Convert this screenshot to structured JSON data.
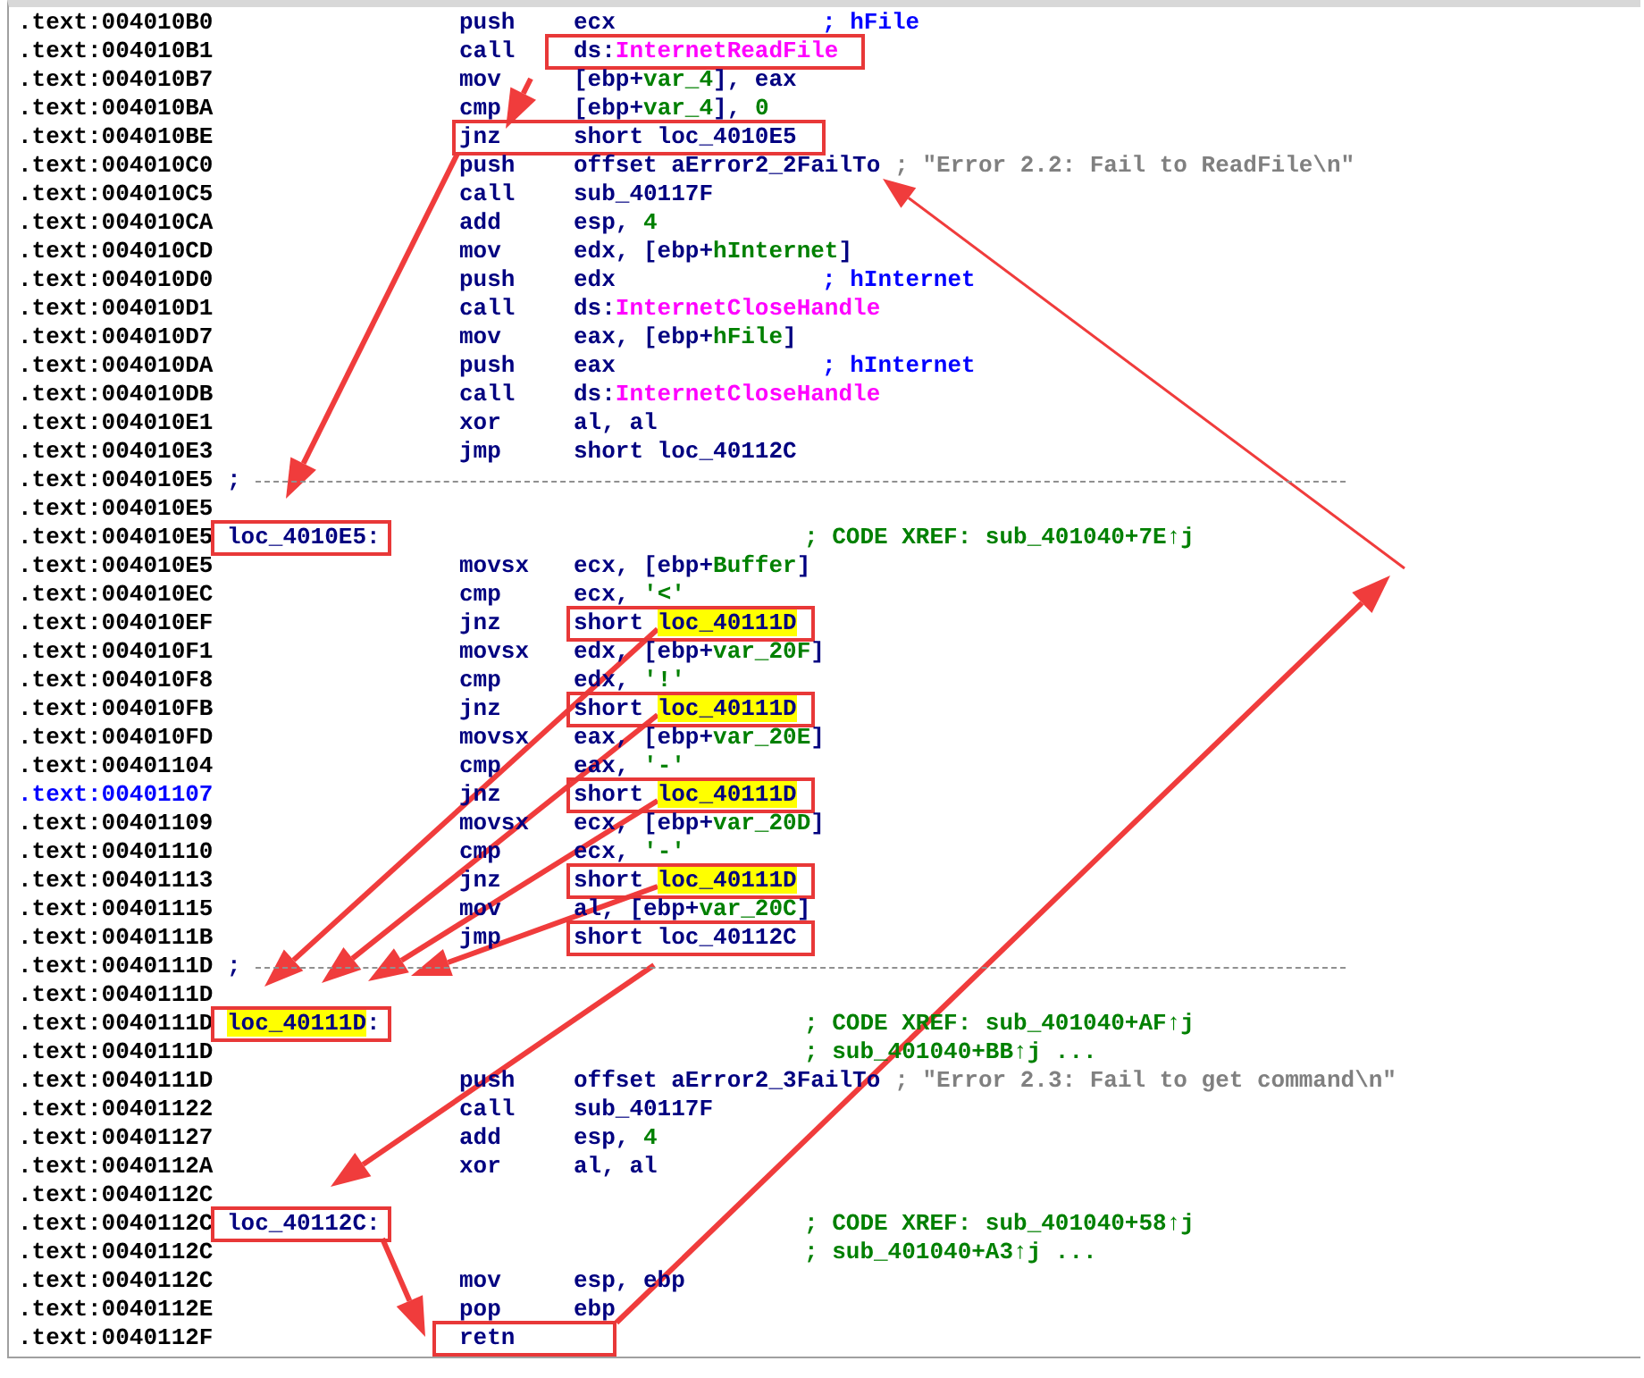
{
  "lines": [
    {
      "kind": "instruction",
      "address": ".text:004010B0",
      "mnemonic": "push",
      "operands": [
        {
          "text": "ecx",
          "kind": "reg"
        }
      ],
      "comment": {
        "text": "; hFile",
        "kind": "arg"
      }
    },
    {
      "kind": "instruction",
      "address": ".text:004010B1",
      "mnemonic": "call",
      "operands": [
        {
          "text": "ds:",
          "kind": "reg"
        },
        {
          "text": "InternetReadFile",
          "kind": "import"
        }
      ],
      "operands_boxed": true
    },
    {
      "kind": "instruction",
      "address": ".text:004010B7",
      "mnemonic": "mov",
      "operands": [
        {
          "text": "[ebp+",
          "kind": "reg"
        },
        {
          "text": "var_4",
          "kind": "var"
        },
        {
          "text": "], eax",
          "kind": "reg"
        }
      ]
    },
    {
      "kind": "instruction",
      "address": ".text:004010BA",
      "mnemonic": "cmp",
      "operands": [
        {
          "text": "[ebp+",
          "kind": "reg"
        },
        {
          "text": "var_4",
          "kind": "var"
        },
        {
          "text": "], ",
          "kind": "reg"
        },
        {
          "text": "0",
          "kind": "num"
        }
      ]
    },
    {
      "kind": "instruction",
      "address": ".text:004010BE",
      "mnemonic": "jnz",
      "operands": [
        {
          "text": "short loc_4010E5",
          "kind": "reg"
        }
      ],
      "boxed": true
    },
    {
      "kind": "instruction",
      "address": ".text:004010C0",
      "mnemonic": "push",
      "operands": [
        {
          "text": "offset aError2_2FailTo",
          "kind": "reg"
        }
      ],
      "comment": {
        "text": "; \"Error 2.2: Fail to ReadFile\\n\"",
        "kind": "string"
      }
    },
    {
      "kind": "instruction",
      "address": ".text:004010C5",
      "mnemonic": "call",
      "operands": [
        {
          "text": "sub_40117F",
          "kind": "reg"
        }
      ]
    },
    {
      "kind": "instruction",
      "address": ".text:004010CA",
      "mnemonic": "add",
      "operands": [
        {
          "text": "esp, ",
          "kind": "reg"
        },
        {
          "text": "4",
          "kind": "num"
        }
      ]
    },
    {
      "kind": "instruction",
      "address": ".text:004010CD",
      "mnemonic": "mov",
      "operands": [
        {
          "text": "edx, [ebp+",
          "kind": "reg"
        },
        {
          "text": "hInternet",
          "kind": "var"
        },
        {
          "text": "]",
          "kind": "reg"
        }
      ]
    },
    {
      "kind": "instruction",
      "address": ".text:004010D0",
      "mnemonic": "push",
      "operands": [
        {
          "text": "edx",
          "kind": "reg"
        }
      ],
      "comment": {
        "text": "; hInternet",
        "kind": "arg"
      }
    },
    {
      "kind": "instruction",
      "address": ".text:004010D1",
      "mnemonic": "call",
      "operands": [
        {
          "text": "ds:",
          "kind": "reg"
        },
        {
          "text": "InternetCloseHandle",
          "kind": "import"
        }
      ]
    },
    {
      "kind": "instruction",
      "address": ".text:004010D7",
      "mnemonic": "mov",
      "operands": [
        {
          "text": "eax, [ebp+",
          "kind": "reg"
        },
        {
          "text": "hFile",
          "kind": "var"
        },
        {
          "text": "]",
          "kind": "reg"
        }
      ]
    },
    {
      "kind": "instruction",
      "address": ".text:004010DA",
      "mnemonic": "push",
      "operands": [
        {
          "text": "eax",
          "kind": "reg"
        }
      ],
      "comment": {
        "text": "; hInternet",
        "kind": "arg"
      }
    },
    {
      "kind": "instruction",
      "address": ".text:004010DB",
      "mnemonic": "call",
      "operands": [
        {
          "text": "ds:",
          "kind": "reg"
        },
        {
          "text": "InternetCloseHandle",
          "kind": "import"
        }
      ]
    },
    {
      "kind": "instruction",
      "address": ".text:004010E1",
      "mnemonic": "xor",
      "operands": [
        {
          "text": "al, al",
          "kind": "reg"
        }
      ]
    },
    {
      "kind": "instruction",
      "address": ".text:004010E3",
      "mnemonic": "jmp",
      "operands": [
        {
          "text": "short loc_40112C",
          "kind": "reg"
        }
      ]
    },
    {
      "kind": "separator",
      "address": ".text:004010E5",
      "mark": ";"
    },
    {
      "kind": "blank",
      "address": ".text:004010E5"
    },
    {
      "kind": "label",
      "address": ".text:004010E5",
      "label": [
        {
          "text": "loc_4010E5:",
          "kind": "reg"
        }
      ],
      "boxed": true,
      "comment": {
        "text": "; CODE XREF: sub_401040+7E↑j",
        "kind": "xref"
      }
    },
    {
      "kind": "instruction",
      "address": ".text:004010E5",
      "mnemonic": "movsx",
      "operands": [
        {
          "text": "ecx, [ebp+",
          "kind": "reg"
        },
        {
          "text": "Buffer",
          "kind": "var"
        },
        {
          "text": "]",
          "kind": "reg"
        }
      ]
    },
    {
      "kind": "instruction",
      "address": ".text:004010EC",
      "mnemonic": "cmp",
      "operands": [
        {
          "text": "ecx, ",
          "kind": "reg"
        },
        {
          "text": "'<'",
          "kind": "num"
        }
      ]
    },
    {
      "kind": "instruction",
      "address": ".text:004010EF",
      "mnemonic": "jnz",
      "operands": [
        {
          "text": "short ",
          "kind": "reg"
        },
        {
          "text": "loc_40111D",
          "kind": "reg",
          "highlighted": true
        }
      ],
      "target_boxed": true
    },
    {
      "kind": "instruction",
      "address": ".text:004010F1",
      "mnemonic": "movsx",
      "operands": [
        {
          "text": "edx, [ebp+",
          "kind": "reg"
        },
        {
          "text": "var_20F",
          "kind": "var"
        },
        {
          "text": "]",
          "kind": "reg"
        }
      ]
    },
    {
      "kind": "instruction",
      "address": ".text:004010F8",
      "mnemonic": "cmp",
      "operands": [
        {
          "text": "edx, ",
          "kind": "reg"
        },
        {
          "text": "'!'",
          "kind": "num"
        }
      ]
    },
    {
      "kind": "instruction",
      "address": ".text:004010FB",
      "mnemonic": "jnz",
      "operands": [
        {
          "text": "short ",
          "kind": "reg"
        },
        {
          "text": "loc_40111D",
          "kind": "reg",
          "highlighted": true
        }
      ],
      "target_boxed": true
    },
    {
      "kind": "instruction",
      "address": ".text:004010FD",
      "mnemonic": "movsx",
      "operands": [
        {
          "text": "eax, [ebp+",
          "kind": "reg"
        },
        {
          "text": "var_20E",
          "kind": "var"
        },
        {
          "text": "]",
          "kind": "reg"
        }
      ]
    },
    {
      "kind": "instruction",
      "address": ".text:00401104",
      "mnemonic": "cmp",
      "operands": [
        {
          "text": "eax, ",
          "kind": "reg"
        },
        {
          "text": "'-'",
          "kind": "num"
        }
      ]
    },
    {
      "kind": "instruction",
      "address": ".text:00401107",
      "current": true,
      "mnemonic": "jnz",
      "operands": [
        {
          "text": "short ",
          "kind": "reg"
        },
        {
          "text": "loc_40111D",
          "kind": "reg",
          "highlighted": true
        }
      ],
      "target_boxed": true
    },
    {
      "kind": "instruction",
      "address": ".text:00401109",
      "mnemonic": "movsx",
      "operands": [
        {
          "text": "ecx, [ebp+",
          "kind": "reg"
        },
        {
          "text": "var_20D",
          "kind": "var"
        },
        {
          "text": "]",
          "kind": "reg"
        }
      ]
    },
    {
      "kind": "instruction",
      "address": ".text:00401110",
      "mnemonic": "cmp",
      "operands": [
        {
          "text": "ecx, ",
          "kind": "reg"
        },
        {
          "text": "'-'",
          "kind": "num"
        }
      ]
    },
    {
      "kind": "instruction",
      "address": ".text:00401113",
      "mnemonic": "jnz",
      "operands": [
        {
          "text": "short ",
          "kind": "reg"
        },
        {
          "text": "loc_40111D",
          "kind": "reg",
          "highlighted": true
        }
      ],
      "target_boxed": true
    },
    {
      "kind": "instruction",
      "address": ".text:00401115",
      "mnemonic": "mov",
      "operands": [
        {
          "text": "al, [ebp+",
          "kind": "reg"
        },
        {
          "text": "var_20C",
          "kind": "var"
        },
        {
          "text": "]",
          "kind": "reg"
        }
      ]
    },
    {
      "kind": "instruction",
      "address": ".text:0040111B",
      "mnemonic": "jmp",
      "operands": [
        {
          "text": "short ",
          "kind": "reg"
        },
        {
          "text": "loc_40112C",
          "kind": "reg"
        }
      ],
      "target_boxed": true
    },
    {
      "kind": "separator",
      "address": ".text:0040111D",
      "mark": ";"
    },
    {
      "kind": "blank",
      "address": ".text:0040111D"
    },
    {
      "kind": "label",
      "address": ".text:0040111D",
      "label": [
        {
          "text": "loc_40111D",
          "kind": "reg",
          "highlighted": true
        },
        {
          "text": ":",
          "kind": "reg"
        }
      ],
      "boxed": true,
      "comment": {
        "text": "; CODE XREF: sub_401040+AF↑j",
        "kind": "xref"
      }
    },
    {
      "kind": "comment",
      "address": ".text:0040111D",
      "comment": {
        "text": "; sub_401040+BB↑j ...",
        "kind": "xref"
      }
    },
    {
      "kind": "instruction",
      "address": ".text:0040111D",
      "mnemonic": "push",
      "operands": [
        {
          "text": "offset aError2_3FailTo",
          "kind": "reg"
        }
      ],
      "comment": {
        "text": "; \"Error 2.3: Fail to get command\\n\"",
        "kind": "string"
      }
    },
    {
      "kind": "instruction",
      "address": ".text:00401122",
      "mnemonic": "call",
      "operands": [
        {
          "text": "sub_40117F",
          "kind": "reg"
        }
      ]
    },
    {
      "kind": "instruction",
      "address": ".text:00401127",
      "mnemonic": "add",
      "operands": [
        {
          "text": "esp, ",
          "kind": "reg"
        },
        {
          "text": "4",
          "kind": "num"
        }
      ]
    },
    {
      "kind": "instruction",
      "address": ".text:0040112A",
      "mnemonic": "xor",
      "operands": [
        {
          "text": "al, al",
          "kind": "reg"
        }
      ]
    },
    {
      "kind": "blank",
      "address": ".text:0040112C"
    },
    {
      "kind": "label",
      "address": ".text:0040112C",
      "label": [
        {
          "text": "loc_40112C:",
          "kind": "reg"
        }
      ],
      "boxed": true,
      "comment": {
        "text": "; CODE XREF: sub_401040+58↑j",
        "kind": "xref"
      }
    },
    {
      "kind": "comment",
      "address": ".text:0040112C",
      "comment": {
        "text": "; sub_401040+A3↑j ...",
        "kind": "xref"
      }
    },
    {
      "kind": "instruction",
      "address": ".text:0040112C",
      "mnemonic": "mov",
      "operands": [
        {
          "text": "esp, ebp",
          "kind": "reg"
        }
      ]
    },
    {
      "kind": "instruction",
      "address": ".text:0040112E",
      "mnemonic": "pop",
      "operands": [
        {
          "text": "ebp",
          "kind": "reg"
        }
      ]
    },
    {
      "kind": "instruction",
      "address": ".text:0040112F",
      "mnemonic": "retn",
      "mnemonic_boxed": true
    }
  ]
}
